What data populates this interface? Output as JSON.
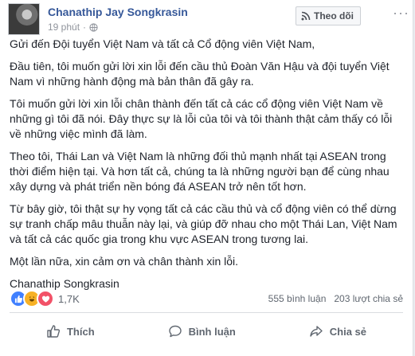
{
  "post": {
    "author": "Chanathip Jay Songkrasin",
    "time": "19 phút",
    "follow_label": "Theo dõi",
    "more_label": "···",
    "paragraphs": [
      "Gửi đến Đội tuyển Việt Nam và tất cả Cổ động viên Việt Nam,",
      "Đầu tiên, tôi muốn gửi lời xin lỗi đến cầu thủ Đoàn Văn Hậu và đội tuyển Việt Nam vì những hành động mà bản thân đã gây ra.",
      "Tôi muốn gửi lời xin lỗi chân thành đến tất cả các cổ động viên Việt Nam về những gì tôi đã nói. Đây thực sự là lỗi của tôi và tôi thành thật cảm thấy có lỗi về những việc mình đã làm.",
      "Theo tôi, Thái Lan và Việt Nam là những đối thủ mạnh nhất tại ASEAN trong thời điểm hiện tại. Và hơn tất cả, chúng ta là những người bạn để cùng nhau xây dựng và phát triển nền bóng đá ASEAN trở nên tốt hơn.",
      "Từ bây giờ, tôi thật sự hy vọng tất cả các cầu thủ và cổ động viên có thể dừng sự tranh chấp mâu thuẫn này lại, và giúp đỡ nhau cho một Thái Lan, Việt Nam và tất cả các quốc gia trong khu vực ASEAN trong tương lai.",
      "Một lần nữa, xin cảm ơn và chân thành xin lỗi.",
      "Chanathip Songkrasin"
    ]
  },
  "stats": {
    "reaction_count": "1,7K",
    "comments": "555 bình luận",
    "shares": "203 lượt chia sẻ"
  },
  "actions": {
    "like": "Thích",
    "comment": "Bình luận",
    "share": "Chia sẻ"
  },
  "colors": {
    "author": "#365899",
    "like_reaction": "#4080ff",
    "haha_reaction": "#f7b125",
    "love_reaction": "#f25268"
  }
}
